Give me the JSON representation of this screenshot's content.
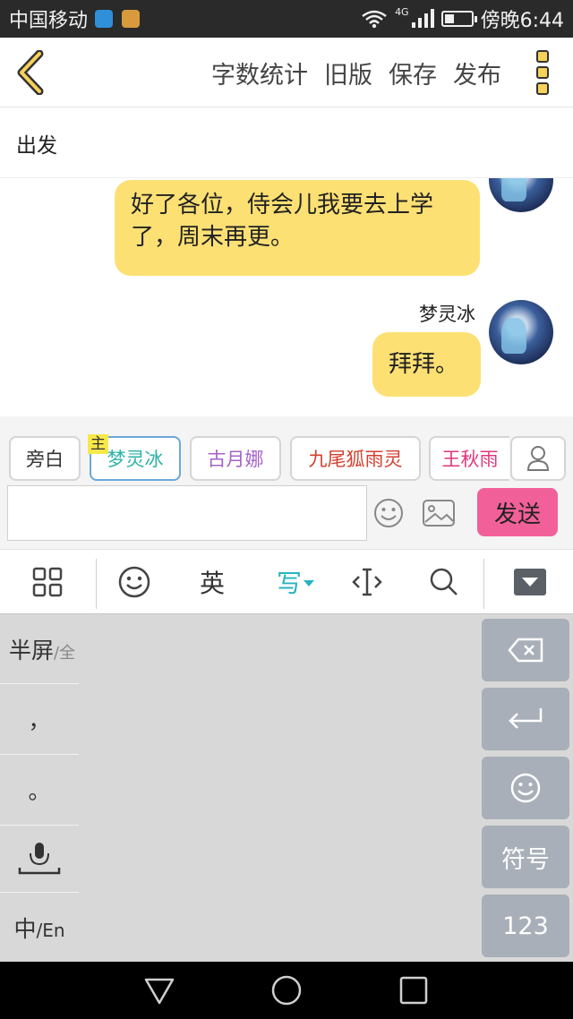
{
  "status_bar": {
    "carrier": "中国移动",
    "network": "4G",
    "time": "傍晚6:44",
    "battery_fraction": 0.35,
    "app_icon_colors": [
      "#2f8fd8",
      "#d89a3c"
    ]
  },
  "toolbar": {
    "back_icon": "chevron-left-icon",
    "word_count_label": "字数统计",
    "old_version_label": "旧版",
    "save_label": "保存",
    "publish_label": "发布",
    "more_icon": "more-dots-icon"
  },
  "story": {
    "title": "出发"
  },
  "chat": {
    "messages": [
      {
        "line1": "好了各位，侍会儿我要去上学",
        "line2": "了，周末再更。"
      },
      {
        "sender": "梦灵冰",
        "text": "拜拜。"
      }
    ]
  },
  "roles": {
    "main_marker": "主",
    "chips": [
      {
        "label": "旁白",
        "color": "#333333"
      },
      {
        "label": "梦灵冰",
        "color": "#2bb3a6"
      },
      {
        "label": "古月娜",
        "color": "#a463c9"
      },
      {
        "label": "九尾狐雨灵",
        "color": "#d2402f"
      },
      {
        "label": "王秋雨",
        "color": "#e0367e"
      }
    ]
  },
  "composer": {
    "input_value": "",
    "send_label": "发送",
    "send_color": "#f2609a"
  },
  "ime_toolbar": {
    "english_label": "英",
    "write_label": "写",
    "write_color": "#27b3c1",
    "icons": [
      "grid-icon",
      "emoji-icon",
      "cursor-icon",
      "search-icon",
      "collapse-keyboard-icon"
    ]
  },
  "keyboard": {
    "half_width_label": "半屏",
    "full_label": "/全",
    "comma": "，",
    "period": "。",
    "zh_label": "中",
    "en_label": "/En",
    "symbol_label": "符号",
    "numbers_label": "123"
  },
  "colors": {
    "bubble": "#fde073",
    "accent_yellow": "#f7d25a",
    "keyboard_bg": "#d8d8d8",
    "function_key": "#a8afb8"
  }
}
